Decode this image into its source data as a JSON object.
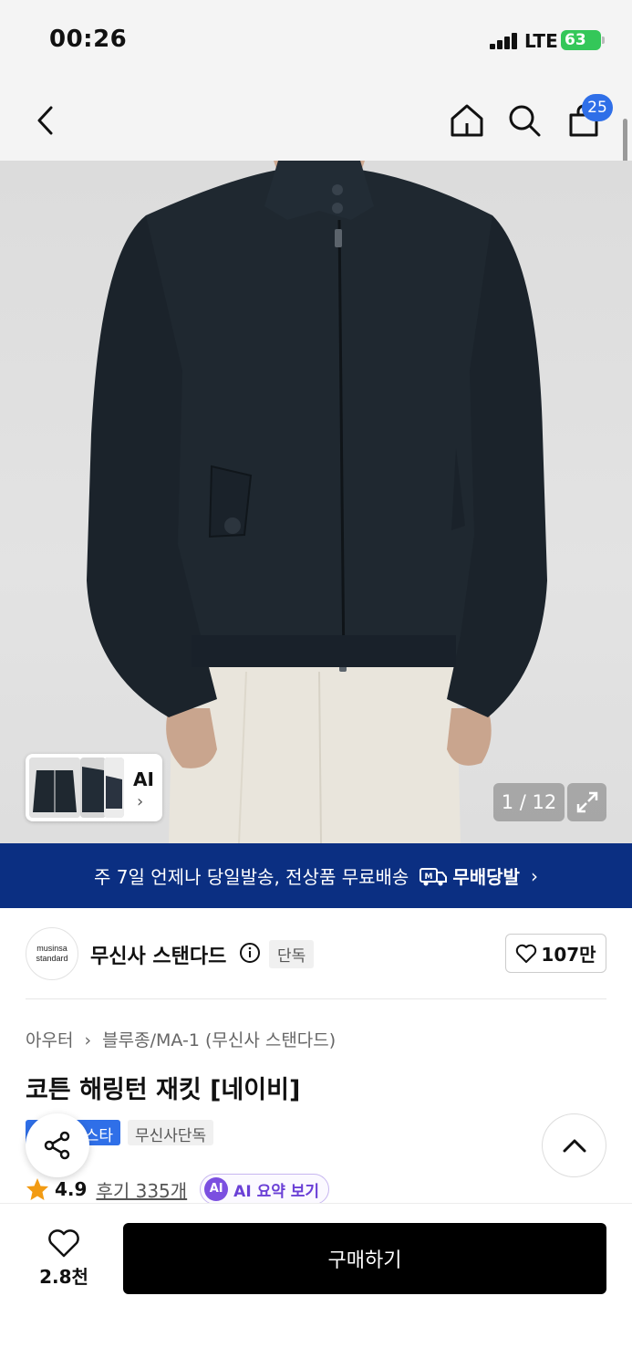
{
  "status_bar": {
    "time": "00:26",
    "network": "LTE",
    "battery": "63"
  },
  "header": {
    "cart_count": "25",
    "icons": [
      "back-icon",
      "home-icon",
      "search-icon",
      "cart-icon"
    ]
  },
  "hero": {
    "page_counter": "1 / 12",
    "ai_label": "AI",
    "chevron": "›",
    "colors": {
      "jacket": "#1f2830",
      "pants": "#e9e5dc",
      "skin": "#c9a58e"
    }
  },
  "banner": {
    "text": "주 7일 언제나 당일발송, 전상품 무료배송",
    "brand": "무배당발",
    "chevron": "›",
    "color": "#0b2f82"
  },
  "brand": {
    "logo_line1": "musinsa",
    "logo_line2": "standard",
    "name": "무신사 스탠다드",
    "tag": "단독",
    "likes": "107만"
  },
  "product": {
    "breadcrumb_1": "아우터",
    "breadcrumb_sep": "›",
    "breadcrumb_2": "블루종/MA-1 (무신사 스탠다드)",
    "title": "코튼 해링턴 재킷 [네이비]",
    "badge_blue": "스타",
    "badge_gray": "무신사단독",
    "rating": "4.9",
    "reviews": "후기 335개",
    "ai_summary_icon": "AI",
    "ai_summary": "AI 요약 보기"
  },
  "bottom": {
    "wish_count": "2.8천",
    "buy_label": "구매하기"
  }
}
